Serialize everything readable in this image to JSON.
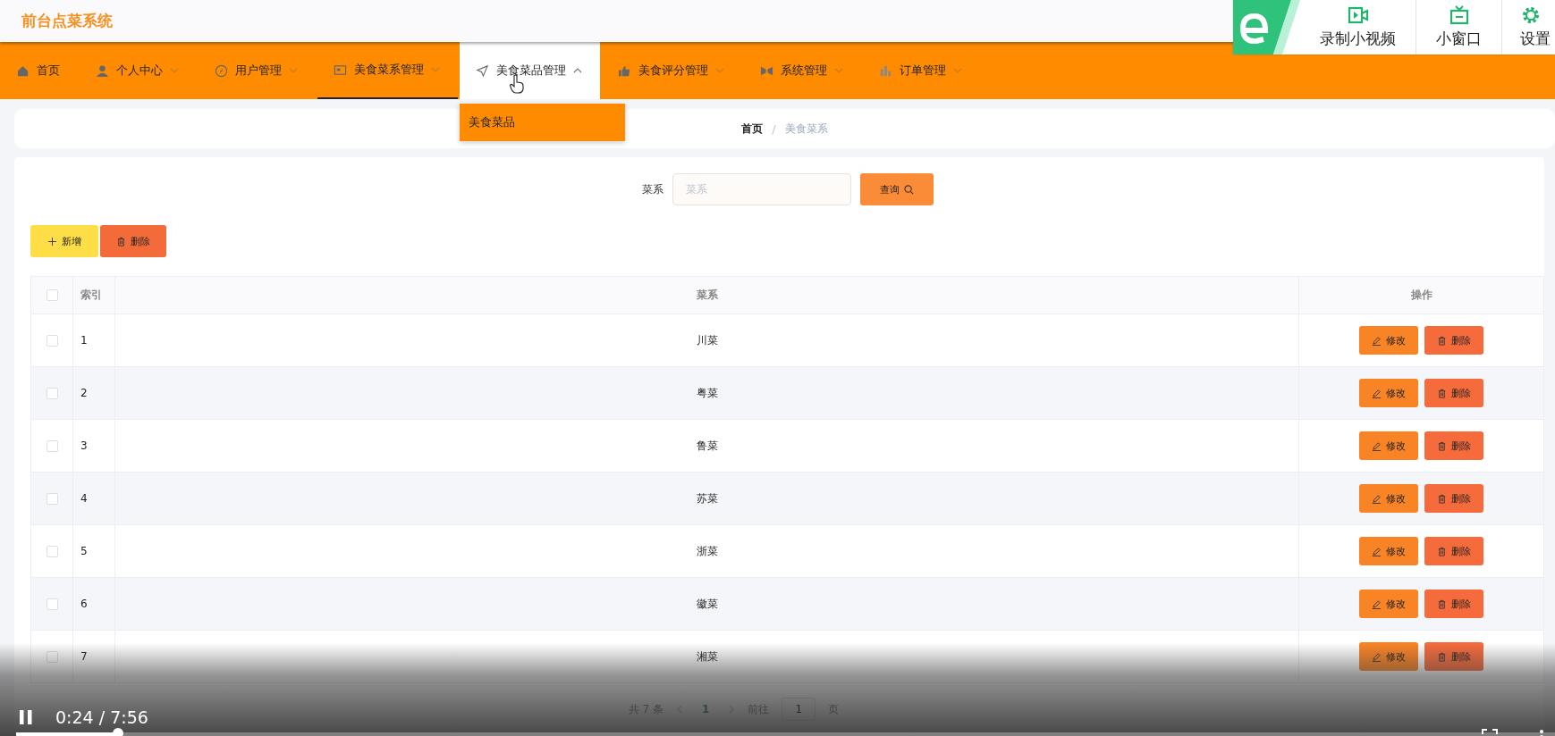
{
  "app_title": "前台点菜系统",
  "nav": [
    {
      "label": "首页",
      "selected": false
    },
    {
      "label": "个人中心",
      "selected": false,
      "expanded": false
    },
    {
      "label": "用户管理",
      "selected": false,
      "expanded": false
    },
    {
      "label": "美食菜系管理",
      "selected": true,
      "expanded": false
    },
    {
      "label": "美食菜品管理",
      "selected": false,
      "expanded": true,
      "submenu": [
        "美食菜品"
      ]
    },
    {
      "label": "美食评分管理",
      "selected": false,
      "expanded": false
    },
    {
      "label": "系统管理",
      "selected": false,
      "expanded": false
    },
    {
      "label": "订单管理",
      "selected": false,
      "expanded": false
    }
  ],
  "browser_toolbar": {
    "buttons": [
      "录制小视频",
      "小窗口",
      "设置"
    ]
  },
  "breadcrumb": {
    "items": [
      "首页",
      "美食菜系"
    ],
    "separator": "/"
  },
  "search": {
    "label": "菜系",
    "placeholder": "菜系",
    "button": "查询"
  },
  "actions": [
    {
      "label": "新增",
      "kind": "add"
    },
    {
      "label": "删除",
      "kind": "delete"
    }
  ],
  "table": {
    "select_all": {
      "checked": false
    },
    "columns": [
      "索引",
      "菜系",
      "操作"
    ],
    "rows": [
      {
        "checked": false,
        "index": "1",
        "name": "川菜",
        "actions": [
          "修改",
          "删除"
        ]
      },
      {
        "checked": false,
        "index": "2",
        "name": "粤菜",
        "actions": [
          "修改",
          "删除"
        ]
      },
      {
        "checked": false,
        "index": "3",
        "name": "鲁菜",
        "actions": [
          "修改",
          "删除"
        ]
      },
      {
        "checked": false,
        "index": "4",
        "name": "苏菜",
        "actions": [
          "修改",
          "删除"
        ]
      },
      {
        "checked": false,
        "index": "5",
        "name": "浙菜",
        "actions": [
          "修改",
          "删除"
        ]
      },
      {
        "checked": false,
        "index": "6",
        "name": "徽菜",
        "actions": [
          "修改",
          "删除"
        ]
      },
      {
        "checked": false,
        "index": "7",
        "name": "湘菜",
        "actions": [
          "修改",
          "删除"
        ]
      }
    ]
  },
  "pagination": {
    "total": "共 7 条",
    "pages": [
      {
        "label": "1",
        "selected": true
      }
    ],
    "goto_label": "前往",
    "goto_value": "1",
    "page_suffix": "页"
  },
  "video_player": {
    "playing": true,
    "time": "0:24 / 7:56",
    "progress": {
      "level": 0.066
    }
  }
}
